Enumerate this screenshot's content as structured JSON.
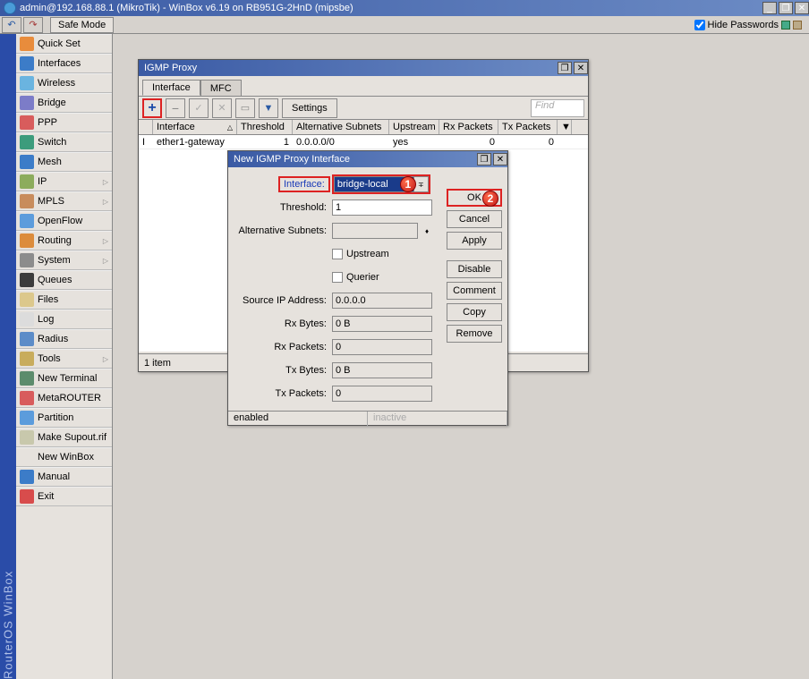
{
  "app": {
    "title": "admin@192.168.88.1 (MikroTik) - WinBox v6.19 on RB951G-2HnD (mipsbe)",
    "hide_passwords": "Hide Passwords",
    "safe_mode": "Safe Mode",
    "left_strip": "RouterOS WinBox"
  },
  "menu": {
    "items": [
      {
        "label": "Quick Set",
        "icon": "#e88c3c"
      },
      {
        "label": "Interfaces",
        "icon": "#3c7cc8"
      },
      {
        "label": "Wireless",
        "icon": "#6ab4e0"
      },
      {
        "label": "Bridge",
        "icon": "#7c7cc8"
      },
      {
        "label": "PPP",
        "icon": "#d85c5c"
      },
      {
        "label": "Switch",
        "icon": "#3c9c7c"
      },
      {
        "label": "Mesh",
        "icon": "#3c7cc8"
      },
      {
        "label": "IP",
        "icon": "#8cac5c",
        "sub": true
      },
      {
        "label": "MPLS",
        "icon": "#c88c5c",
        "sub": true
      },
      {
        "label": "OpenFlow",
        "icon": "#5c9cdc"
      },
      {
        "label": "Routing",
        "icon": "#dc8c3c",
        "sub": true
      },
      {
        "label": "System",
        "icon": "#8c8c8c",
        "sub": true
      },
      {
        "label": "Queues",
        "icon": "#3c3c3c"
      },
      {
        "label": "Files",
        "icon": "#dcc88c"
      },
      {
        "label": "Log",
        "icon": "#dcdcdc"
      },
      {
        "label": "Radius",
        "icon": "#5c8cc8"
      },
      {
        "label": "Tools",
        "icon": "#c8ac5c",
        "sub": true
      },
      {
        "label": "New Terminal",
        "icon": "#5c8c6c"
      },
      {
        "label": "MetaROUTER",
        "icon": "#d85c5c"
      },
      {
        "label": "Partition",
        "icon": "#5c9cdc"
      },
      {
        "label": "Make Supout.rif",
        "icon": "#c8c8ac"
      },
      {
        "label": "New WinBox",
        "icon": ""
      },
      {
        "label": "Manual",
        "icon": "#3c7cc8"
      },
      {
        "label": "Exit",
        "icon": "#d84c4c"
      }
    ]
  },
  "igmp_window": {
    "title": "IGMP Proxy",
    "tabs": [
      "Interface",
      "MFC"
    ],
    "toolbar": {
      "settings": "Settings",
      "find": "Find"
    },
    "columns": [
      "",
      "Interface",
      "Threshold",
      "Alternative Subnets",
      "Upstream",
      "Rx Packets",
      "Tx Packets"
    ],
    "rows": [
      {
        "flag": "I",
        "interface": "ether1-gateway",
        "threshold": "1",
        "alt": "0.0.0.0/0",
        "upstream": "yes",
        "rx": "0",
        "tx": "0"
      }
    ],
    "status": "1 item"
  },
  "new_iface_window": {
    "title": "New IGMP Proxy Interface",
    "labels": {
      "interface": "Interface:",
      "threshold": "Threshold:",
      "alt": "Alternative Subnets:",
      "upstream": "Upstream",
      "querier": "Querier",
      "source": "Source IP Address:",
      "rxb": "Rx Bytes:",
      "rxp": "Rx Packets:",
      "txb": "Tx Bytes:",
      "txp": "Tx Packets:"
    },
    "values": {
      "interface": "bridge-local",
      "threshold": "1",
      "alt": "",
      "source": "0.0.0.0",
      "rxb": "0 B",
      "rxp": "0",
      "txb": "0 B",
      "txp": "0"
    },
    "buttons": {
      "ok": "OK",
      "cancel": "Cancel",
      "apply": "Apply",
      "disable": "Disable",
      "comment": "Comment",
      "copy": "Copy",
      "remove": "Remove"
    },
    "status": {
      "enabled": "enabled",
      "inactive": "inactive"
    },
    "markers": {
      "one": "1",
      "two": "2"
    }
  }
}
